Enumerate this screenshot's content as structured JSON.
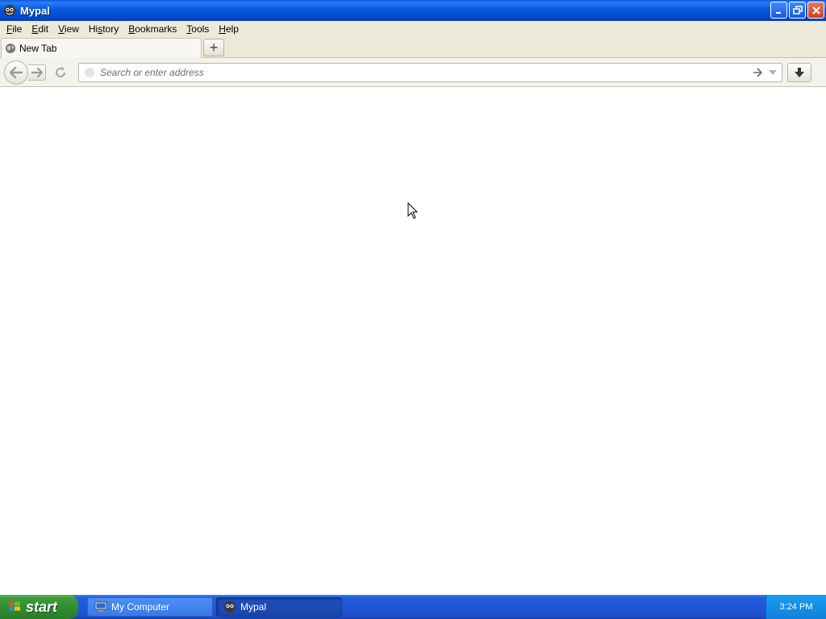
{
  "window": {
    "title": "Mypal",
    "controls": {
      "minimize": "minimize-icon",
      "restore": "restore-icon",
      "close": "close-icon"
    }
  },
  "menubar": {
    "items": [
      {
        "pre": "",
        "acc": "F",
        "post": "ile"
      },
      {
        "pre": "",
        "acc": "E",
        "post": "dit"
      },
      {
        "pre": "",
        "acc": "V",
        "post": "iew"
      },
      {
        "pre": "Hi",
        "acc": "s",
        "post": "tory"
      },
      {
        "pre": "",
        "acc": "B",
        "post": "ookmarks"
      },
      {
        "pre": "",
        "acc": "T",
        "post": "ools"
      },
      {
        "pre": "",
        "acc": "H",
        "post": "elp"
      }
    ]
  },
  "tabs": [
    {
      "label": "New Tab",
      "icon": "globe-icon"
    }
  ],
  "newtab": {
    "icon": "plus-icon",
    "glyph": "+"
  },
  "navbar": {
    "back_icon": "back-arrow-icon",
    "forward_icon": "forward-arrow-icon",
    "reload_icon": "reload-icon",
    "url": {
      "value": "",
      "placeholder": "Search or enter address"
    },
    "go_icon": "go-arrow-icon",
    "download_icon": "download-icon"
  },
  "taskbar": {
    "start_label": "start",
    "tasks": [
      {
        "label": "My Computer",
        "icon": "computer-icon"
      },
      {
        "label": "Mypal",
        "icon": "mypal-icon"
      }
    ],
    "clock": "3:24 PM"
  },
  "colors": {
    "titlebar": "#0558e0",
    "menubar": "#ece9d8",
    "taskbar": "#245edb",
    "start": "#3c9a3c"
  }
}
